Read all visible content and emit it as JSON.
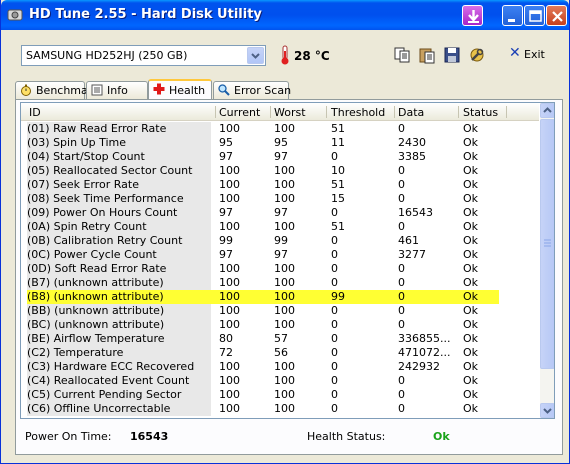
{
  "window": {
    "title": "HD Tune 2.55 - Hard Disk Utility"
  },
  "toolbar": {
    "drive": "SAMSUNG HD252HJ (250 GB)",
    "temperature": "28 °C",
    "exit_label": "Exit"
  },
  "tabs": [
    {
      "label": "Benchmark",
      "icon": "stopwatch-icon",
      "active": false
    },
    {
      "label": "Info",
      "icon": "info-icon",
      "active": false
    },
    {
      "label": "Health",
      "icon": "health-cross-icon",
      "active": true
    },
    {
      "label": "Error Scan",
      "icon": "magnifier-icon",
      "active": false
    }
  ],
  "table": {
    "columns": [
      "ID",
      "Current",
      "Worst",
      "Threshold",
      "Data",
      "Status"
    ],
    "highlighted_row": 14,
    "highlight_color": "#ffff33",
    "rows": [
      [
        "(01) Raw Read Error Rate",
        "100",
        "100",
        "51",
        "0",
        "Ok"
      ],
      [
        "(03) Spin Up Time",
        "95",
        "95",
        "11",
        "2430",
        "Ok"
      ],
      [
        "(04) Start/Stop Count",
        "97",
        "97",
        "0",
        "3385",
        "Ok"
      ],
      [
        "(05) Reallocated Sector Count",
        "100",
        "100",
        "10",
        "0",
        "Ok"
      ],
      [
        "(07) Seek Error Rate",
        "100",
        "100",
        "51",
        "0",
        "Ok"
      ],
      [
        "(08) Seek Time Performance",
        "100",
        "100",
        "15",
        "0",
        "Ok"
      ],
      [
        "(09) Power On Hours Count",
        "97",
        "97",
        "0",
        "16543",
        "Ok"
      ],
      [
        "(0A) Spin Retry Count",
        "100",
        "100",
        "51",
        "0",
        "Ok"
      ],
      [
        "(0B) Calibration Retry Count",
        "99",
        "99",
        "0",
        "461",
        "Ok"
      ],
      [
        "(0C) Power Cycle Count",
        "97",
        "97",
        "0",
        "3277",
        "Ok"
      ],
      [
        "(0D) Soft Read Error Rate",
        "100",
        "100",
        "0",
        "0",
        "Ok"
      ],
      [
        "(B7) (unknown attribute)",
        "100",
        "100",
        "0",
        "0",
        "Ok"
      ],
      [
        "(B8) (unknown attribute)",
        "100",
        "100",
        "99",
        "0",
        "Ok"
      ],
      [
        "(BB) (unknown attribute)",
        "100",
        "100",
        "0",
        "0",
        "Ok"
      ],
      [
        "(BC) (unknown attribute)",
        "100",
        "100",
        "0",
        "0",
        "Ok"
      ],
      [
        "(BE) Airflow Temperature",
        "80",
        "57",
        "0",
        "336855...",
        "Ok"
      ],
      [
        "(C2) Temperature",
        "72",
        "56",
        "0",
        "471072...",
        "Ok"
      ],
      [
        "(C3) Hardware ECC Recovered",
        "100",
        "100",
        "0",
        "242932",
        "Ok"
      ],
      [
        "(C4) Reallocated Event Count",
        "100",
        "100",
        "0",
        "0",
        "Ok"
      ],
      [
        "(C5) Current Pending Sector",
        "100",
        "100",
        "0",
        "0",
        "Ok"
      ],
      [
        "(C6) Offline Uncorrectable",
        "100",
        "100",
        "0",
        "0",
        "Ok"
      ]
    ]
  },
  "footer": {
    "power_on_label": "Power On Time:",
    "power_on_value": "16543",
    "health_label": "Health Status:",
    "health_value": "Ok",
    "health_color": "#1aa31a"
  }
}
